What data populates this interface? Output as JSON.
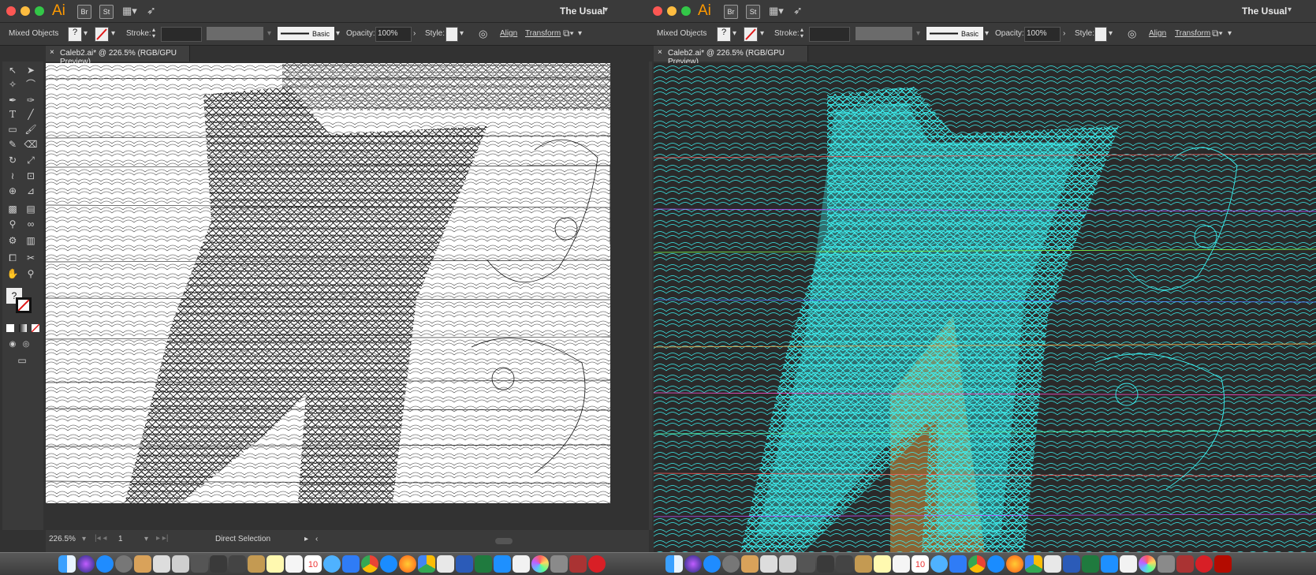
{
  "app": {
    "name": "Ai",
    "bridge": "Br",
    "stock": "St",
    "workspace": "The Usual"
  },
  "control_bar": {
    "selection": "Mixed Objects",
    "stroke_label": "Stroke:",
    "brush_label": "Basic",
    "opacity_label": "Opacity:",
    "opacity_value": "100%",
    "style_label": "Style:",
    "align_label": "Align",
    "transform_label": "Transform"
  },
  "document_tab": {
    "title": "Caleb2.ai* @ 226.5% (RGB/GPU Preview)",
    "close": "×"
  },
  "status": {
    "zoom": "226.5%",
    "artboard": "1",
    "tool": "Direct Selection"
  },
  "tools": {
    "unknown": "?"
  },
  "colors": {
    "accent": "#ff9a00",
    "outline": "#3cf0f0",
    "canvas_white": "#ffffff",
    "chrome": "#3a3a3a"
  },
  "dock": {
    "calendar_day": "10",
    "icons": [
      "finder",
      "siri",
      "app-store",
      "launchpad",
      "safari",
      "mail",
      "calendar",
      "notes",
      "reminders",
      "photos",
      "chrome",
      "firefox",
      "drive",
      "word",
      "excel",
      "music",
      "illustrator",
      "creative-cloud",
      "acrobat"
    ]
  }
}
